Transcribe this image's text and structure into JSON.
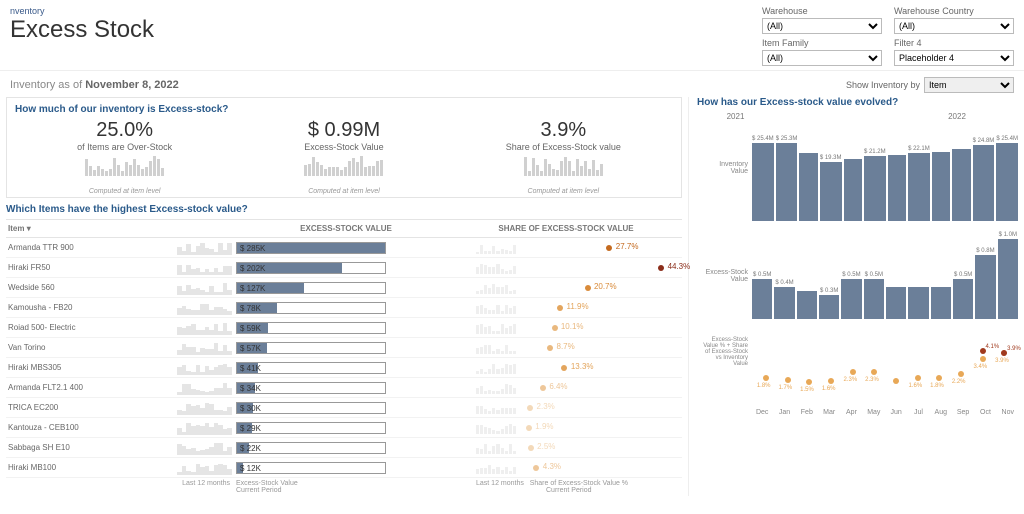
{
  "breadcrumb": "nventory",
  "title": "Excess Stock",
  "filters": {
    "warehouse": {
      "label": "Warehouse",
      "value": "(All)"
    },
    "warehouse_country": {
      "label": "Warehouse Country",
      "value": "(All)"
    },
    "item_family": {
      "label": "Item Family",
      "value": "(All)"
    },
    "filter4": {
      "label": "Filter 4",
      "value": "Placeholder 4"
    }
  },
  "asof": {
    "prefix": "Inventory as of",
    "date": "November 8, 2022"
  },
  "show_by": {
    "label": "Show Inventory by",
    "value": "Item"
  },
  "kpi_section": {
    "title": "How much of our inventory is Excess-stock?",
    "computed": "Computed at item level",
    "pct_over": {
      "value": "25.0%",
      "sub": "of Items are Over-Stock"
    },
    "value": {
      "value": "$ 0.99M",
      "sub": "Excess-Stock Value"
    },
    "share": {
      "value": "3.9%",
      "sub": "Share of Excess-Stock value"
    }
  },
  "items_section": {
    "title": "Which Items have the highest Excess-stock value?",
    "headers": {
      "item": "Item",
      "value": "EXCESS-STOCK VALUE",
      "share": "SHARE OF EXCESS-STOCK VALUE"
    },
    "items": [
      {
        "name": "Armanda TTR 900",
        "value_label": "$ 285K",
        "bar_pct": 100,
        "share_pct": 27.7,
        "share_label": "27.7%",
        "color": "#c46a1f"
      },
      {
        "name": "Hiraki FR50",
        "value_label": "$ 202K",
        "bar_pct": 71,
        "share_pct": 44.3,
        "share_label": "44.3%",
        "color": "#8b2d1a"
      },
      {
        "name": "Wedside 560",
        "value_label": "$ 127K",
        "bar_pct": 45,
        "share_pct": 20.7,
        "share_label": "20.7%",
        "color": "#d98b3a"
      },
      {
        "name": "Kamousha - FB20",
        "value_label": "$ 78K",
        "bar_pct": 27,
        "share_pct": 11.9,
        "share_label": "11.9%",
        "color": "#e3a55d"
      },
      {
        "name": "Roiad 500- Electric",
        "value_label": "$ 59K",
        "bar_pct": 21,
        "share_pct": 10.1,
        "share_label": "10.1%",
        "color": "#e9b87e"
      },
      {
        "name": "Van Torino",
        "value_label": "$ 57K",
        "bar_pct": 20,
        "share_pct": 8.7,
        "share_label": "8.7%",
        "color": "#e9b87e"
      },
      {
        "name": "Hiraki MBS305",
        "value_label": "$ 41K",
        "bar_pct": 14,
        "share_pct": 13.3,
        "share_label": "13.3%",
        "color": "#e3a55d"
      },
      {
        "name": "Armanda FLT2.1 400",
        "value_label": "$ 34K",
        "bar_pct": 12,
        "share_pct": 6.4,
        "share_label": "6.4%",
        "color": "#eec79a"
      },
      {
        "name": "TRICA EC200",
        "value_label": "$ 30K",
        "bar_pct": 11,
        "share_pct": 2.3,
        "share_label": "2.3%",
        "color": "#f3d9b9"
      },
      {
        "name": "Kantouza - CEB100",
        "value_label": "$ 29K",
        "bar_pct": 10,
        "share_pct": 1.9,
        "share_label": "1.9%",
        "color": "#f3d9b9"
      },
      {
        "name": "Sabbaga SH E10",
        "value_label": "$ 22K",
        "bar_pct": 8,
        "share_pct": 2.5,
        "share_label": "2.5%",
        "color": "#f3d9b9"
      },
      {
        "name": "Hiraki MB100",
        "value_label": "$ 12K",
        "bar_pct": 4,
        "share_pct": 4.3,
        "share_label": "4.3%",
        "color": "#eec79a"
      }
    ],
    "footer": {
      "last12": "Last 12 months",
      "v1": "Excess-Stock Value",
      "v2": "Current Period",
      "s1": "Share of Excess-Stock Value %",
      "s2": "Current Period"
    }
  },
  "evolution": {
    "title": "How has our Excess-stock value evolved?",
    "year1": "2021",
    "year2": "2022",
    "months": [
      "Dec",
      "Jan",
      "Feb",
      "Mar",
      "Apr",
      "May",
      "Jun",
      "Jul",
      "Aug",
      "Sep",
      "Oct",
      "Nov"
    ],
    "inventory": {
      "label": "Inventory Value",
      "labels": [
        "$ 25.4M",
        "$ 25.3M",
        "",
        "$ 19.3M",
        "",
        "$ 21.2M",
        "",
        "$ 22.1M",
        "",
        "",
        "$ 24.8M",
        "$ 25.4M"
      ],
      "values": [
        25.4,
        25.3,
        22.0,
        19.3,
        20.0,
        21.2,
        21.5,
        22.1,
        22.5,
        23.5,
        24.8,
        25.4
      ]
    },
    "excess": {
      "label": "Excess-Stock Value",
      "labels": [
        "$ 0.5M",
        "$ 0.4M",
        "",
        "$ 0.3M",
        "$ 0.5M",
        "$ 0.5M",
        "",
        "",
        "",
        "$ 0.5M",
        "$ 0.8M",
        "$ 1.0M"
      ],
      "second_labels": [
        "",
        "",
        "",
        "",
        "",
        "",
        "",
        "",
        "",
        "",
        "",
        "$ 1.0M"
      ],
      "values": [
        0.5,
        0.4,
        0.35,
        0.3,
        0.5,
        0.5,
        0.4,
        0.4,
        0.4,
        0.5,
        0.8,
        1.0
      ]
    },
    "pct": {
      "label": "Excess-Stock Value % + Share of Excess-Stock vs Inventory Value",
      "series1": [
        1.8,
        1.7,
        1.5,
        1.6,
        2.3,
        2.3,
        1.6,
        1.8,
        1.8,
        2.2,
        3.4,
        3.9
      ],
      "series1_labels": [
        "1.8%",
        "1.7%",
        "1.5%",
        "1.6%",
        "2.3%",
        "2.3%",
        "",
        "1.6%",
        "1.8%",
        "2.2%",
        "3.4%",
        "3.9%"
      ],
      "series2_top": [
        4.1,
        3.9
      ],
      "colors": {
        "s1": "#e8a857",
        "s2": "#a03a1e"
      }
    }
  },
  "chart_data": [
    {
      "type": "bar",
      "title": "Excess-Stock Value by Item",
      "categories": [
        "Armanda TTR 900",
        "Hiraki FR50",
        "Wedside 560",
        "Kamousha - FB20",
        "Roiad 500- Electric",
        "Van Torino",
        "Hiraki MBS305",
        "Armanda FLT2.1 400",
        "TRICA EC200",
        "Kantouza - CEB100",
        "Sabbaga SH E10",
        "Hiraki MB100"
      ],
      "values": [
        285,
        202,
        127,
        78,
        59,
        57,
        41,
        34,
        30,
        29,
        22,
        12
      ],
      "unit": "$K"
    },
    {
      "type": "scatter",
      "title": "Share of Excess-Stock Value % by Item",
      "categories": [
        "Armanda TTR 900",
        "Hiraki FR50",
        "Wedside 560",
        "Kamousha - FB20",
        "Roiad 500- Electric",
        "Van Torino",
        "Hiraki MBS305",
        "Armanda FLT2.1 400",
        "TRICA EC200",
        "Kantouza - CEB100",
        "Sabbaga SH E10",
        "Hiraki MB100"
      ],
      "values": [
        27.7,
        44.3,
        20.7,
        11.9,
        10.1,
        8.7,
        13.3,
        6.4,
        2.3,
        1.9,
        2.5,
        4.3
      ],
      "unit": "%"
    },
    {
      "type": "bar",
      "title": "Inventory Value trend",
      "categories": [
        "Dec",
        "Jan",
        "Feb",
        "Mar",
        "Apr",
        "May",
        "Jun",
        "Jul",
        "Aug",
        "Sep",
        "Oct",
        "Nov"
      ],
      "values": [
        25.4,
        25.3,
        22.0,
        19.3,
        20.0,
        21.2,
        21.5,
        22.1,
        22.5,
        23.5,
        24.8,
        25.4
      ],
      "unit": "$M"
    },
    {
      "type": "bar",
      "title": "Excess-Stock Value trend",
      "categories": [
        "Dec",
        "Jan",
        "Feb",
        "Mar",
        "Apr",
        "May",
        "Jun",
        "Jul",
        "Aug",
        "Sep",
        "Oct",
        "Nov"
      ],
      "values": [
        0.5,
        0.4,
        0.35,
        0.3,
        0.5,
        0.5,
        0.4,
        0.4,
        0.4,
        0.5,
        0.8,
        1.0
      ],
      "unit": "$M"
    },
    {
      "type": "scatter",
      "title": "Excess-Stock Value % trend",
      "categories": [
        "Dec",
        "Jan",
        "Feb",
        "Mar",
        "Apr",
        "May",
        "Jun",
        "Jul",
        "Aug",
        "Sep",
        "Oct",
        "Nov"
      ],
      "series": [
        {
          "name": "Share",
          "values": [
            1.8,
            1.7,
            1.5,
            1.6,
            2.3,
            2.3,
            1.6,
            1.8,
            1.8,
            2.2,
            3.4,
            3.9
          ]
        }
      ],
      "unit": "%"
    }
  ]
}
